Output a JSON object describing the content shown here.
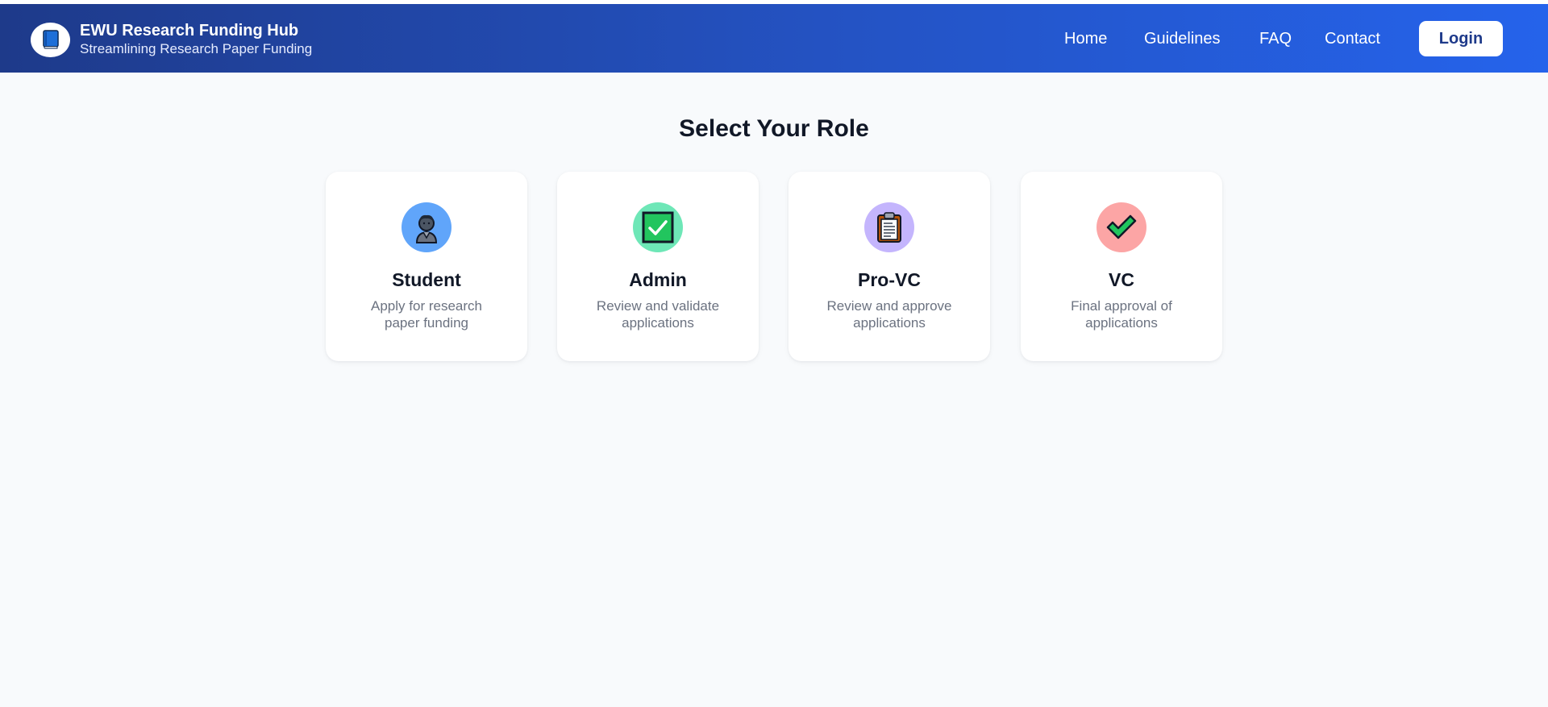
{
  "header": {
    "title": "EWU Research Funding Hub",
    "subtitle": "Streamlining Research Paper Funding",
    "logo_icon": "book-icon",
    "nav": {
      "home": "Home",
      "guidelines": "Guidelines",
      "faq": "FAQ",
      "contact": "Contact"
    },
    "login_label": "Login"
  },
  "main": {
    "title": "Select Your Role",
    "roles": [
      {
        "title": "Student",
        "description": "Apply for research paper funding",
        "icon": "student-icon",
        "icon_bg": "#60a5fa"
      },
      {
        "title": "Admin",
        "description": "Review and validate applications",
        "icon": "check-box-icon",
        "icon_bg": "#6ee7b7"
      },
      {
        "title": "Pro-VC",
        "description": "Review and approve applications",
        "icon": "clipboard-icon",
        "icon_bg": "#c4b5fd"
      },
      {
        "title": "VC",
        "description": "Final approval of applications",
        "icon": "check-mark-icon",
        "icon_bg": "#fca5a5"
      }
    ]
  },
  "colors": {
    "header_start": "#1e3a8a",
    "header_end": "#2563eb",
    "page_bg": "#f8fafc",
    "title_text": "#111827",
    "muted_text": "#6b7280"
  }
}
